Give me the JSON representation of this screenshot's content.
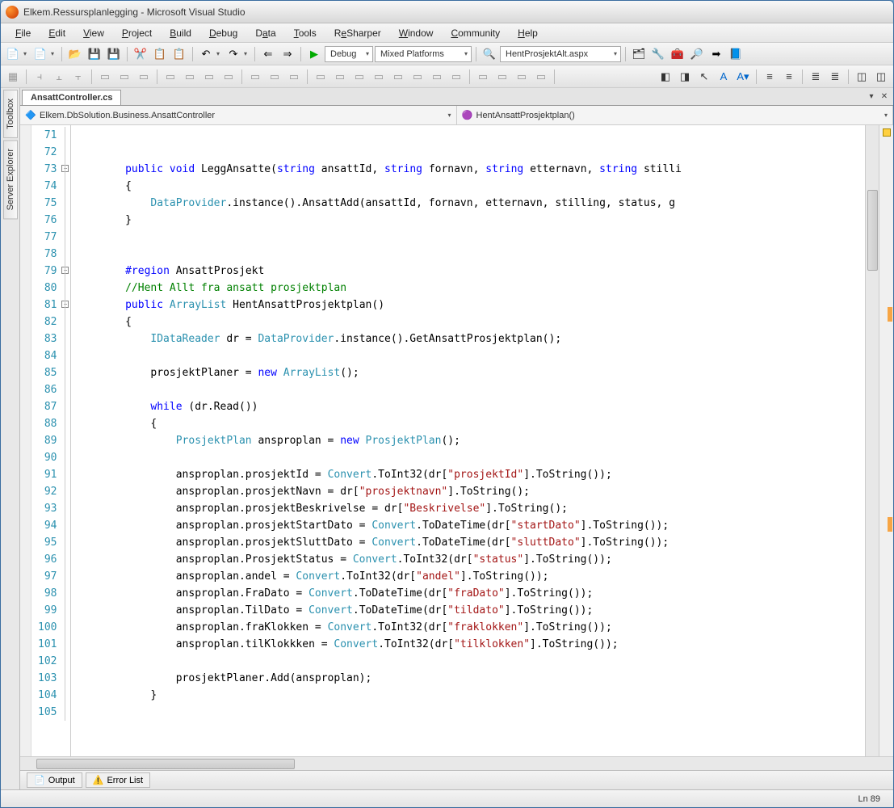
{
  "window": {
    "title": "Elkem.Ressursplanlegging - Microsoft Visual Studio"
  },
  "menu": {
    "file": "File",
    "edit": "Edit",
    "view": "View",
    "project": "Project",
    "build": "Build",
    "debug": "Debug",
    "data": "Data",
    "tools": "Tools",
    "resharper": "ReSharper",
    "window": "Window",
    "community": "Community",
    "help": "Help"
  },
  "toolbar1": {
    "config": "Debug",
    "platform": "Mixed Platforms",
    "startup_file": "HentProsjektAlt.aspx"
  },
  "sidebar": {
    "toolbox": "Toolbox",
    "server_explorer": "Server Explorer"
  },
  "doc_tab": {
    "active": "AnsattController.cs"
  },
  "nav": {
    "class_path": "Elkem.DbSolution.Business.AnsattController",
    "method": "HentAnsattProsjektplan()"
  },
  "code": {
    "lines": [
      {
        "n": 71,
        "segs": [
          ""
        ]
      },
      {
        "n": 72,
        "segs": [
          ""
        ]
      },
      {
        "n": 73,
        "segs": [
          "        ",
          {
            "c": "kw",
            "t": "public"
          },
          " ",
          {
            "c": "kw",
            "t": "void"
          },
          " LeggAnsatte(",
          {
            "c": "kw",
            "t": "string"
          },
          " ansattId, ",
          {
            "c": "kw",
            "t": "string"
          },
          " fornavn, ",
          {
            "c": "kw",
            "t": "string"
          },
          " etternavn, ",
          {
            "c": "kw",
            "t": "string"
          },
          " stilli"
        ]
      },
      {
        "n": 74,
        "segs": [
          "        {"
        ]
      },
      {
        "n": 75,
        "segs": [
          "            ",
          {
            "c": "typ",
            "t": "DataProvider"
          },
          ".instance().AnsattAdd(ansattId, fornavn, etternavn, stilling, status, g"
        ]
      },
      {
        "n": 76,
        "segs": [
          "        }"
        ]
      },
      {
        "n": 77,
        "segs": [
          ""
        ]
      },
      {
        "n": 78,
        "segs": [
          ""
        ]
      },
      {
        "n": 79,
        "segs": [
          "        ",
          {
            "c": "reg",
            "t": "#region"
          },
          " AnsattProsjekt"
        ]
      },
      {
        "n": 80,
        "segs": [
          "        ",
          {
            "c": "com",
            "t": "//Hent Allt fra ansatt prosjektplan"
          }
        ]
      },
      {
        "n": 81,
        "segs": [
          "        ",
          {
            "c": "kw",
            "t": "public"
          },
          " ",
          {
            "c": "typ",
            "t": "ArrayList"
          },
          " HentAnsattProsjektplan()"
        ]
      },
      {
        "n": 82,
        "segs": [
          "        {"
        ]
      },
      {
        "n": 83,
        "segs": [
          "            ",
          {
            "c": "typ",
            "t": "IDataReader"
          },
          " dr = ",
          {
            "c": "typ",
            "t": "DataProvider"
          },
          ".instance().GetAnsattProsjektplan();"
        ]
      },
      {
        "n": 84,
        "segs": [
          ""
        ]
      },
      {
        "n": 85,
        "segs": [
          "            prosjektPlaner = ",
          {
            "c": "kw",
            "t": "new"
          },
          " ",
          {
            "c": "typ",
            "t": "ArrayList"
          },
          "();"
        ]
      },
      {
        "n": 86,
        "segs": [
          ""
        ]
      },
      {
        "n": 87,
        "segs": [
          "            ",
          {
            "c": "kw",
            "t": "while"
          },
          " (dr.Read())"
        ]
      },
      {
        "n": 88,
        "segs": [
          "            {"
        ]
      },
      {
        "n": 89,
        "segs": [
          "                ",
          {
            "c": "typ",
            "t": "ProsjektPlan"
          },
          " ansproplan = ",
          {
            "c": "kw",
            "t": "new"
          },
          " ",
          {
            "c": "typ",
            "t": "ProsjektPlan"
          },
          "();"
        ]
      },
      {
        "n": 90,
        "segs": [
          ""
        ]
      },
      {
        "n": 91,
        "segs": [
          "                ansproplan.prosjektId = ",
          {
            "c": "typ",
            "t": "Convert"
          },
          ".ToInt32(dr[",
          {
            "c": "str",
            "t": "\"prosjektId\""
          },
          "].ToString());"
        ]
      },
      {
        "n": 92,
        "segs": [
          "                ansproplan.prosjektNavn = dr[",
          {
            "c": "str",
            "t": "\"prosjektnavn\""
          },
          "].ToString();"
        ]
      },
      {
        "n": 93,
        "segs": [
          "                ansproplan.prosjektBeskrivelse = dr[",
          {
            "c": "str",
            "t": "\"Beskrivelse\""
          },
          "].ToString();"
        ]
      },
      {
        "n": 94,
        "segs": [
          "                ansproplan.prosjektStartDato = ",
          {
            "c": "typ",
            "t": "Convert"
          },
          ".ToDateTime(dr[",
          {
            "c": "str",
            "t": "\"startDato\""
          },
          "].ToString());"
        ]
      },
      {
        "n": 95,
        "segs": [
          "                ansproplan.prosjektSluttDato = ",
          {
            "c": "typ",
            "t": "Convert"
          },
          ".ToDateTime(dr[",
          {
            "c": "str",
            "t": "\"sluttDato\""
          },
          "].ToString());"
        ]
      },
      {
        "n": 96,
        "segs": [
          "                ansproplan.ProsjektStatus = ",
          {
            "c": "typ",
            "t": "Convert"
          },
          ".ToInt32(dr[",
          {
            "c": "str",
            "t": "\"status\""
          },
          "].ToString());"
        ]
      },
      {
        "n": 97,
        "segs": [
          "                ansproplan.andel = ",
          {
            "c": "typ",
            "t": "Convert"
          },
          ".ToInt32(dr[",
          {
            "c": "str",
            "t": "\"andel\""
          },
          "].ToString());"
        ]
      },
      {
        "n": 98,
        "segs": [
          "                ansproplan.FraDato = ",
          {
            "c": "typ",
            "t": "Convert"
          },
          ".ToDateTime(dr[",
          {
            "c": "str",
            "t": "\"fraDato\""
          },
          "].ToString());"
        ]
      },
      {
        "n": 99,
        "segs": [
          "                ansproplan.TilDato = ",
          {
            "c": "typ",
            "t": "Convert"
          },
          ".ToDateTime(dr[",
          {
            "c": "str",
            "t": "\"tildato\""
          },
          "].ToString());"
        ]
      },
      {
        "n": 100,
        "segs": [
          "                ansproplan.fraKlokken = ",
          {
            "c": "typ",
            "t": "Convert"
          },
          ".ToInt32(dr[",
          {
            "c": "str",
            "t": "\"fraklokken\""
          },
          "].ToString());"
        ]
      },
      {
        "n": 101,
        "segs": [
          "                ansproplan.tilKlokkken = ",
          {
            "c": "typ",
            "t": "Convert"
          },
          ".ToInt32(dr[",
          {
            "c": "str",
            "t": "\"tilklokken\""
          },
          "].ToString());"
        ]
      },
      {
        "n": 102,
        "segs": [
          ""
        ]
      },
      {
        "n": 103,
        "segs": [
          "                prosjektPlaner.Add(ansproplan);"
        ]
      },
      {
        "n": 104,
        "segs": [
          "            }"
        ]
      },
      {
        "n": 105,
        "segs": [
          ""
        ]
      }
    ]
  },
  "bottom": {
    "output": "Output",
    "error_list": "Error List"
  },
  "status": {
    "line": "Ln 89"
  }
}
